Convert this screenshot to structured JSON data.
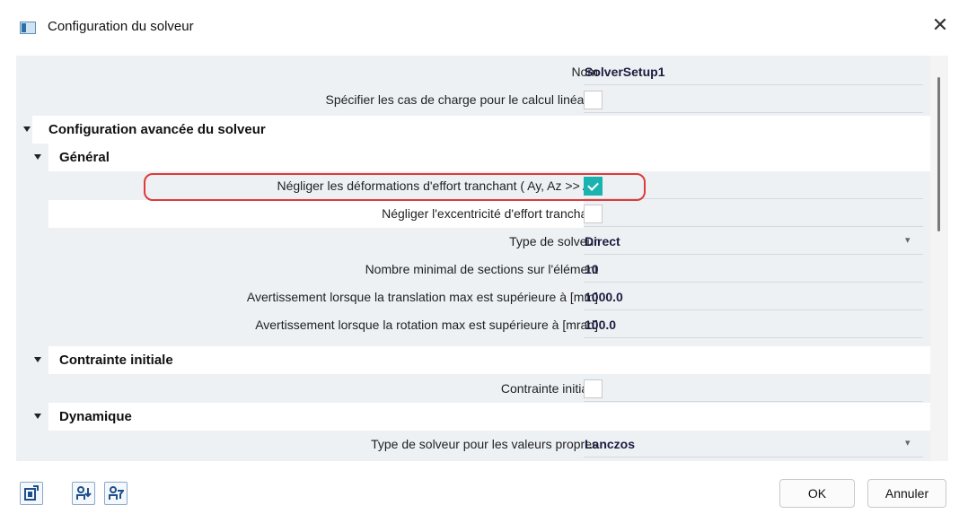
{
  "window": {
    "title": "Configuration du solveur",
    "close_glyph": "✕"
  },
  "grid": {
    "name": {
      "label": "Nom",
      "value": "SolverSetup1"
    },
    "specify_loadcases": {
      "label": "Spécifier les cas de charge pour le calcul linéaire",
      "checked": false
    },
    "cat_advanced": "Configuration avancée du solveur",
    "cat_general": "Général",
    "neglect_shear_deformation": {
      "label": "Négliger les déformations d'effort tranchant ( Ay, Az >> A )",
      "checked": true
    },
    "neglect_shear_eccentricity": {
      "label": "Négliger l'excentricité d'effort tranchant",
      "checked": false
    },
    "solver_type": {
      "label": "Type de solveur",
      "value": "Direct"
    },
    "min_sections": {
      "label": "Nombre minimal de sections sur l'élément",
      "value": "10"
    },
    "warn_translation": {
      "label": "Avertissement lorsque la translation max est supérieure à [mm]",
      "value": "1000.0"
    },
    "warn_rotation": {
      "label": "Avertissement lorsque la rotation max est supérieure à [mrad]",
      "value": "100.0"
    },
    "cat_initial_stress": "Contrainte initiale",
    "initial_stress": {
      "label": "Contrainte initiale",
      "checked": false
    },
    "cat_dynamics": "Dynamique",
    "eigen_solver_type": {
      "label": "Type de solveur pour les valeurs propres",
      "value": "Lanczos"
    }
  },
  "footer": {
    "ok_label": "OK",
    "cancel_label": "Annuler",
    "tool_icons": [
      "export-icon",
      "sort-icon",
      "filter-icon"
    ]
  },
  "colors": {
    "checkbox_checked": "#1bb3b0",
    "highlight_border": "#e03a3a",
    "value_text": "#1c1c40"
  }
}
